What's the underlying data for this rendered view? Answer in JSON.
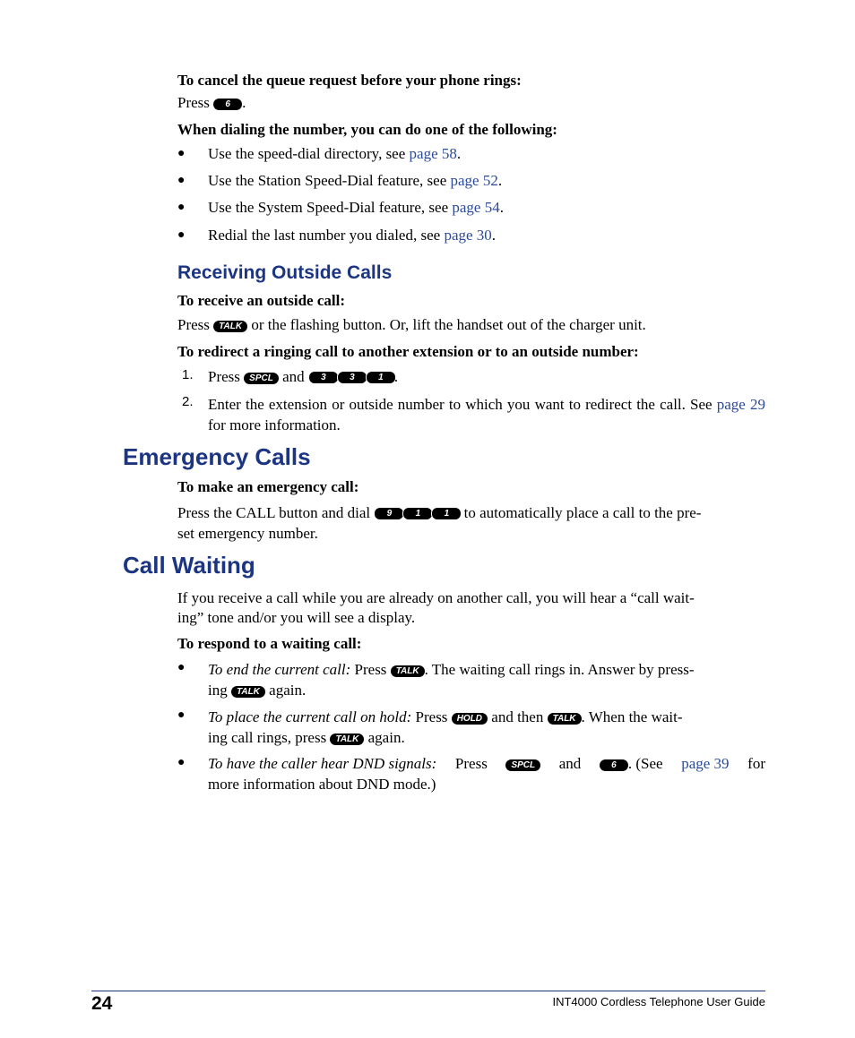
{
  "cancel_queue": {
    "heading": "To cancel the queue request before your phone rings:",
    "press": "Press",
    "key": "6",
    "end": "."
  },
  "dialing": {
    "heading": "When dialing the number, you can do one of the following:",
    "items": [
      {
        "text": "Use the speed-dial directory, see ",
        "link": "page 58",
        "end": "."
      },
      {
        "text": "Use the Station Speed-Dial feature, see ",
        "link": "page 52",
        "end": "."
      },
      {
        "text": "Use the System Speed-Dial feature, see ",
        "link": "page 54",
        "end": "."
      },
      {
        "text": "Redial the last number you dialed, see ",
        "link": "page 30",
        "end": "."
      }
    ]
  },
  "receiving": {
    "title": "Receiving Outside Calls",
    "receive_heading": "To receive an outside call:",
    "receive_press": "Press",
    "receive_key": "TALK",
    "receive_rest": "or the flashing button. Or, lift the handset out of the charger unit.",
    "redirect_heading": "To redirect a ringing call to another extension or to an outside number:",
    "steps": [
      {
        "num": "1.",
        "press": "Press",
        "key": "SPCL",
        "and": "and",
        "keys": [
          "3",
          "3",
          "1"
        ],
        "end": "."
      },
      {
        "num": "2.",
        "text": "Enter the extension or outside number to which you want to redirect the call. See",
        "link": "page 29",
        "rest": " for more information."
      }
    ]
  },
  "emergency": {
    "title": "Emergency Calls",
    "heading": "To make an emergency call:",
    "text_before": "Press the CALL button and dial",
    "keys": [
      "9",
      "1",
      "1"
    ],
    "text_after": "to automatically place a call to the pre-",
    "text_line2": "set emergency number."
  },
  "call_waiting": {
    "title": "Call Waiting",
    "intro_line1": "If you receive a call while you are already on another call, you will hear a “call wait-",
    "intro_line2": "ing” tone and/or you will see a display.",
    "respond_heading": "To respond to a waiting call:",
    "items": [
      {
        "lead": "To end the current call:",
        "press": "Press",
        "key1": "TALK",
        "mid": ". The waiting call rings in. Answer by press-",
        "line2_pre": "ing",
        "key2": "TALK",
        "line2_post": "again."
      },
      {
        "lead": "To place the current call on hold:",
        "press": "Press",
        "key1": "HOLD",
        "mid": "and then",
        "key2": "TALK",
        "mid2": ". When the wait-",
        "line2_pre": "ing call rings, press",
        "key3": "TALK",
        "line2_post": "again."
      },
      {
        "lead": "To have the caller hear DND signals:",
        "press": "Press",
        "key1": "SPCL",
        "mid": "and",
        "key2": "6",
        "mid2": ". (See",
        "link": "page 39",
        "tail": "for",
        "line2": "more information about DND mode.)"
      }
    ]
  },
  "footer": {
    "page_number": "24",
    "guide_title": "INT4000 Cordless Telephone User Guide"
  }
}
